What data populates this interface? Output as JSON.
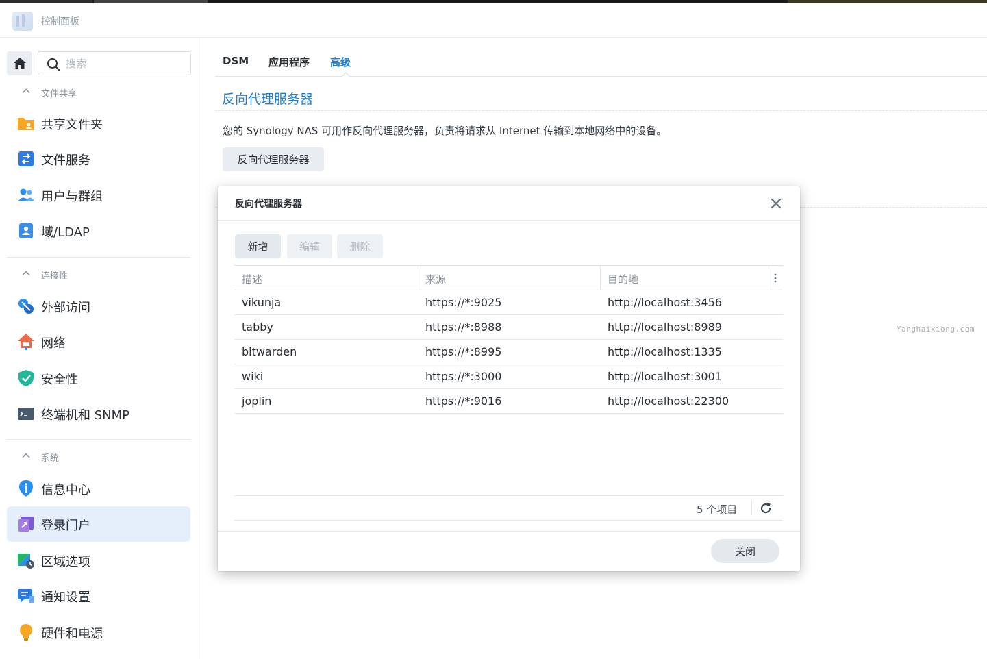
{
  "app": {
    "title": "控制面板"
  },
  "search": {
    "placeholder": "搜索"
  },
  "sidebar": {
    "sections": [
      {
        "label": "文件共享",
        "items": [
          {
            "label": "共享文件夹",
            "icon": "folder-share-icon"
          },
          {
            "label": "文件服务",
            "icon": "file-services-icon"
          },
          {
            "label": "用户与群组",
            "icon": "users-groups-icon"
          },
          {
            "label": "域/LDAP",
            "icon": "domain-ldap-icon"
          }
        ]
      },
      {
        "label": "连接性",
        "items": [
          {
            "label": "外部访问",
            "icon": "external-access-icon"
          },
          {
            "label": "网络",
            "icon": "network-icon"
          },
          {
            "label": "安全性",
            "icon": "security-shield-icon"
          },
          {
            "label": "终端机和 SNMP",
            "icon": "terminal-icon"
          }
        ]
      },
      {
        "label": "系统",
        "items": [
          {
            "label": "信息中心",
            "icon": "info-center-icon"
          },
          {
            "label": "登录门户",
            "icon": "login-portal-icon",
            "active": true
          },
          {
            "label": "区域选项",
            "icon": "regional-options-icon"
          },
          {
            "label": "通知设置",
            "icon": "notification-icon"
          },
          {
            "label": "硬件和电源",
            "icon": "hardware-power-icon"
          }
        ]
      }
    ]
  },
  "tabs": [
    {
      "label": "DSM",
      "active": false
    },
    {
      "label": "应用程序",
      "active": false
    },
    {
      "label": "高级",
      "active": true
    }
  ],
  "section": {
    "title": "反向代理服务器",
    "description": "您的 Synology NAS 可用作反向代理服务器，负责将请求从 Internet 传输到本地网络中的设备。",
    "button_label": "反向代理服务器"
  },
  "watermark": "Yanghaixiong.com",
  "dialog": {
    "title": "反向代理服务器",
    "toolbar": {
      "add_label": "新增",
      "edit_label": "编辑",
      "delete_label": "删除"
    },
    "columns": [
      "描述",
      "来源",
      "目的地"
    ],
    "rows": [
      {
        "description": "vikunja",
        "source": "https://*:9025",
        "destination": "http://localhost:3456"
      },
      {
        "description": "tabby",
        "source": "https://*:8988",
        "destination": "http://localhost:8989"
      },
      {
        "description": "bitwarden",
        "source": "https://*:8995",
        "destination": "http://localhost:1335"
      },
      {
        "description": "wiki",
        "source": "https://*:3000",
        "destination": "http://localhost:3001"
      },
      {
        "description": "joplin",
        "source": "https://*:9016",
        "destination": "http://localhost:22300"
      }
    ],
    "item_count": "5 个项目",
    "close_label": "关闭"
  },
  "colors": {
    "accent": "#1a7fd4",
    "active_bg": "#e4effb"
  }
}
